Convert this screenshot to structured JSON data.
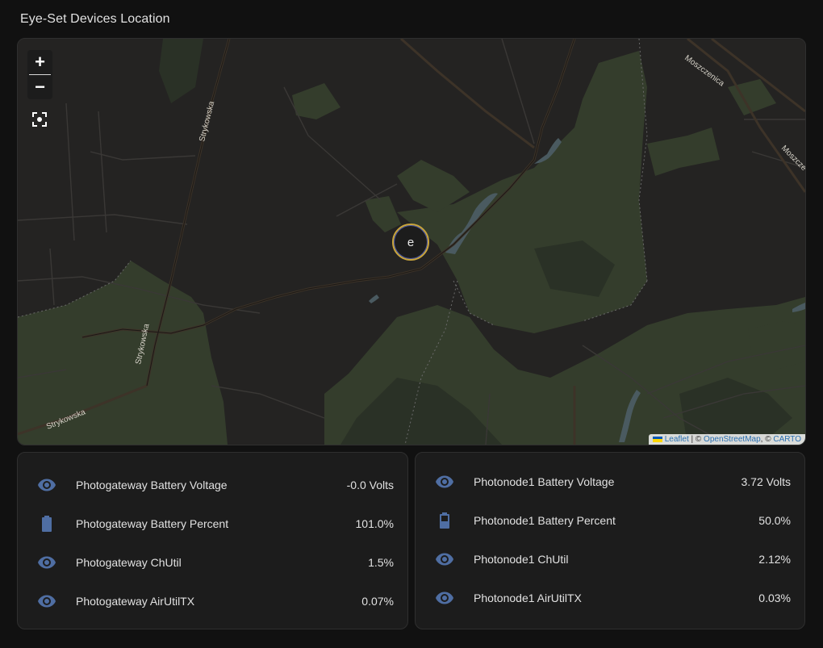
{
  "card": {
    "title": "Eye-Set Devices Location"
  },
  "map": {
    "zoom_in_label": "+",
    "zoom_out_label": "−",
    "marker_label": "e",
    "street_labels": [
      "Strykowska",
      "Strykowska",
      "Strykowska",
      "Moszczenica",
      "Moszcze"
    ],
    "attribution": {
      "leaflet": "Leaflet",
      "sep1": " | © ",
      "osm": "OpenStreetMap",
      "sep2": ", © ",
      "carto": "CARTO"
    }
  },
  "gateway": {
    "rows": [
      {
        "label": "Photogateway Battery Voltage",
        "value": "-0.0 Volts",
        "icon": "eye-icon"
      },
      {
        "label": "Photogateway Battery Percent",
        "value": "101.0%",
        "icon": "battery-full-icon"
      },
      {
        "label": "Photogateway ChUtil",
        "value": "1.5%",
        "icon": "eye-icon"
      },
      {
        "label": "Photogateway AirUtilTX",
        "value": "0.07%",
        "icon": "eye-icon"
      }
    ]
  },
  "node": {
    "rows": [
      {
        "label": "Photonode1 Battery Voltage",
        "value": "3.72 Volts",
        "icon": "eye-icon"
      },
      {
        "label": "Photonode1 Battery Percent",
        "value": "50.0%",
        "icon": "battery-half-icon"
      },
      {
        "label": "Photonode1 ChUtil",
        "value": "2.12%",
        "icon": "eye-icon"
      },
      {
        "label": "Photonode1 AirUtilTX",
        "value": "0.03%",
        "icon": "eye-icon"
      }
    ]
  },
  "colors": {
    "accent_icon": "#4f6ea3",
    "marker_ring": "#c8a43c",
    "forest": "#343d2c",
    "water": "#4a5a60"
  }
}
